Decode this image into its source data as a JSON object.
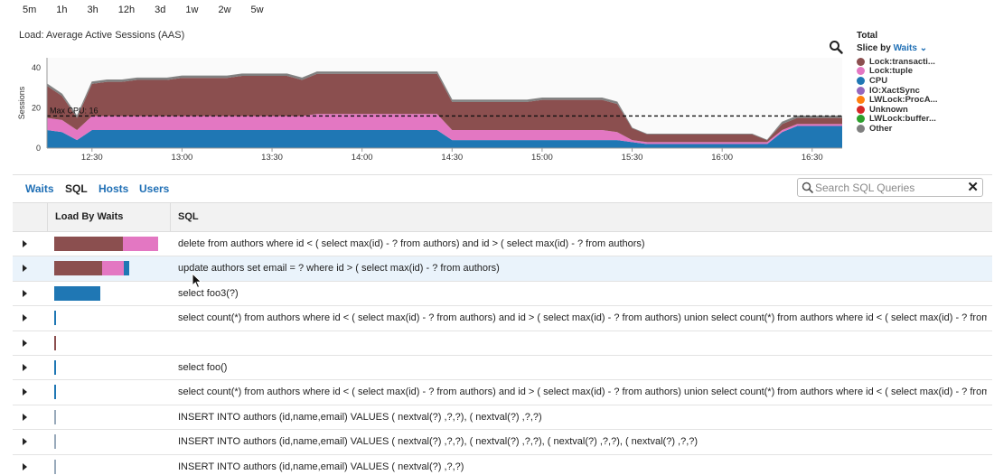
{
  "time_ranges": [
    "5m",
    "1h",
    "3h",
    "12h",
    "3d",
    "1w",
    "2w",
    "5w"
  ],
  "chart_title": "Load: Average Active Sessions (AAS)",
  "legend": {
    "title": "Total",
    "slice_label": "Slice by",
    "slice_value": "Waits",
    "items": [
      {
        "label": "Lock:transacti...",
        "color": "#8b4f4f"
      },
      {
        "label": "Lock:tuple",
        "color": "#e377c2"
      },
      {
        "label": "CPU",
        "color": "#1f77b4"
      },
      {
        "label": "IO:XactSync",
        "color": "#9467bd"
      },
      {
        "label": "LWLock:ProcA...",
        "color": "#ff7f0e"
      },
      {
        "label": "Unknown",
        "color": "#d62728"
      },
      {
        "label": "LWLock:buffer...",
        "color": "#2ca02c"
      },
      {
        "label": "Other",
        "color": "#7f7f7f"
      }
    ]
  },
  "chart_data": {
    "type": "area",
    "ylabel": "Sessions",
    "yticks": [
      "0",
      "20",
      "40"
    ],
    "ylim": [
      0,
      45
    ],
    "xlim": [
      "12:15",
      "16:40"
    ],
    "xticks": [
      "12:30",
      "13:00",
      "13:30",
      "14:00",
      "14:30",
      "15:00",
      "15:30",
      "16:00",
      "16:30"
    ],
    "threshold": {
      "label": "Max CPU: 16",
      "value": 16
    },
    "x": [
      "12:15",
      "12:20",
      "12:25",
      "12:30",
      "12:35",
      "12:40",
      "12:45",
      "12:50",
      "12:55",
      "13:00",
      "13:05",
      "13:10",
      "13:15",
      "13:20",
      "13:25",
      "13:30",
      "13:35",
      "13:40",
      "13:45",
      "13:50",
      "13:55",
      "14:00",
      "14:05",
      "14:10",
      "14:15",
      "14:20",
      "14:25",
      "14:30",
      "14:35",
      "14:40",
      "14:45",
      "14:50",
      "14:55",
      "15:00",
      "15:05",
      "15:10",
      "15:15",
      "15:20",
      "15:25",
      "15:30",
      "15:35",
      "15:40",
      "15:45",
      "15:50",
      "15:55",
      "16:00",
      "16:05",
      "16:10",
      "16:15",
      "16:20",
      "16:25",
      "16:30",
      "16:35",
      "16:40"
    ],
    "series": [
      {
        "name": "CPU",
        "values": [
          9,
          8,
          4,
          9,
          9,
          9,
          9,
          9,
          9,
          9,
          9,
          9,
          9,
          9,
          9,
          9,
          9,
          9,
          9,
          9,
          9,
          9,
          9,
          9,
          9,
          9,
          9,
          4,
          4,
          4,
          4,
          4,
          4,
          4,
          4,
          4,
          4,
          4,
          4,
          3,
          2,
          2,
          2,
          2,
          2,
          2,
          2,
          2,
          2,
          8,
          11,
          11,
          11,
          11
        ]
      },
      {
        "name": "Lock:tuple",
        "values": [
          6,
          6,
          5,
          7,
          7,
          7,
          7,
          7,
          7,
          7,
          7,
          7,
          7,
          7,
          7,
          7,
          7,
          7,
          8,
          8,
          8,
          8,
          8,
          8,
          8,
          8,
          8,
          5,
          5,
          5,
          5,
          5,
          5,
          5,
          5,
          5,
          5,
          5,
          4,
          1,
          1,
          1,
          1,
          1,
          1,
          1,
          1,
          1,
          1,
          1,
          1,
          1,
          1,
          1
        ]
      },
      {
        "name": "Lock:transacti...",
        "values": [
          16,
          12,
          6,
          16,
          17,
          17,
          18,
          18,
          18,
          19,
          19,
          19,
          19,
          20,
          20,
          20,
          20,
          18,
          20,
          20,
          20,
          20,
          20,
          20,
          20,
          20,
          20,
          14,
          14,
          14,
          14,
          14,
          14,
          15,
          15,
          15,
          15,
          15,
          14,
          6,
          4,
          4,
          4,
          4,
          4,
          4,
          4,
          4,
          1,
          3,
          3,
          3,
          3,
          3
        ]
      },
      {
        "name": "Other",
        "values": [
          1,
          1,
          1,
          1,
          1,
          1,
          1,
          1,
          1,
          1,
          1,
          1,
          1,
          1,
          1,
          1,
          1,
          1,
          1,
          1,
          1,
          1,
          1,
          1,
          1,
          1,
          1,
          1,
          1,
          1,
          1,
          1,
          1,
          1,
          1,
          1,
          1,
          1,
          1,
          0,
          0,
          0,
          0,
          0,
          0,
          0,
          0,
          0,
          0,
          1,
          1,
          1,
          1,
          1
        ]
      }
    ]
  },
  "tabs": [
    {
      "label": "Waits",
      "active": false
    },
    {
      "label": "SQL",
      "active": true
    },
    {
      "label": "Hosts",
      "active": false
    },
    {
      "label": "Users",
      "active": false
    }
  ],
  "search": {
    "placeholder": "Search SQL Queries",
    "value": ""
  },
  "table": {
    "headers": {
      "load": "Load By Waits",
      "sql": "SQL"
    },
    "rows": [
      {
        "sql": "delete from authors where id < ( select max(id) - ? from authors) and id > ( select max(id) - ? from authors)",
        "load": [
          {
            "color": "#8b4f4f",
            "value": 0.66
          },
          {
            "color": "#e377c2",
            "value": 0.34
          }
        ],
        "selected": false
      },
      {
        "sql": "update authors set email = ? where id > ( select max(id) - ? from authors)",
        "load": [
          {
            "color": "#8b4f4f",
            "value": 0.46
          },
          {
            "color": "#e377c2",
            "value": 0.21
          },
          {
            "color": "#1f77b4",
            "value": 0.05
          }
        ],
        "selected": true
      },
      {
        "sql": "select foo3(?)",
        "load": [
          {
            "color": "#1f77b4",
            "value": 0.44
          }
        ],
        "selected": false
      },
      {
        "sql": "select count(*) from authors where id < ( select max(id) - ? from authors) and id > ( select max(id) - ? from authors) union select count(*) from authors where id < ( select max(id) - ? from...",
        "load": [
          {
            "color": "#1f77b4",
            "value": 0.015
          }
        ],
        "selected": false
      },
      {
        "sql": "",
        "load": [
          {
            "color": "#8b4f4f",
            "value": 0.012
          }
        ],
        "selected": false
      },
      {
        "sql": "select foo()",
        "load": [
          {
            "color": "#1f77b4",
            "value": 0.01
          }
        ],
        "selected": false
      },
      {
        "sql": "select count(*) from authors where id < ( select max(id) - ? from authors) and id > ( select max(id) - ? from authors) union select count(*) from authors where id < ( select max(id) - ? from...",
        "load": [
          {
            "color": "#1f77b4",
            "value": 0.008
          }
        ],
        "selected": false
      },
      {
        "sql": "INSERT INTO authors (id,name,email) VALUES ( nextval(?) ,?,?), ( nextval(?) ,?,?)",
        "load": [
          {
            "color": "#9ab",
            "value": 0.006
          }
        ],
        "selected": false
      },
      {
        "sql": "INSERT INTO authors (id,name,email) VALUES ( nextval(?) ,?,?), ( nextval(?) ,?,?), ( nextval(?) ,?,?), ( nextval(?) ,?,?)",
        "load": [
          {
            "color": "#9ab",
            "value": 0.006
          }
        ],
        "selected": false
      },
      {
        "sql": "INSERT INTO authors (id,name,email) VALUES ( nextval(?) ,?,?)",
        "load": [
          {
            "color": "#9ab",
            "value": 0.006
          }
        ],
        "selected": false
      }
    ]
  }
}
